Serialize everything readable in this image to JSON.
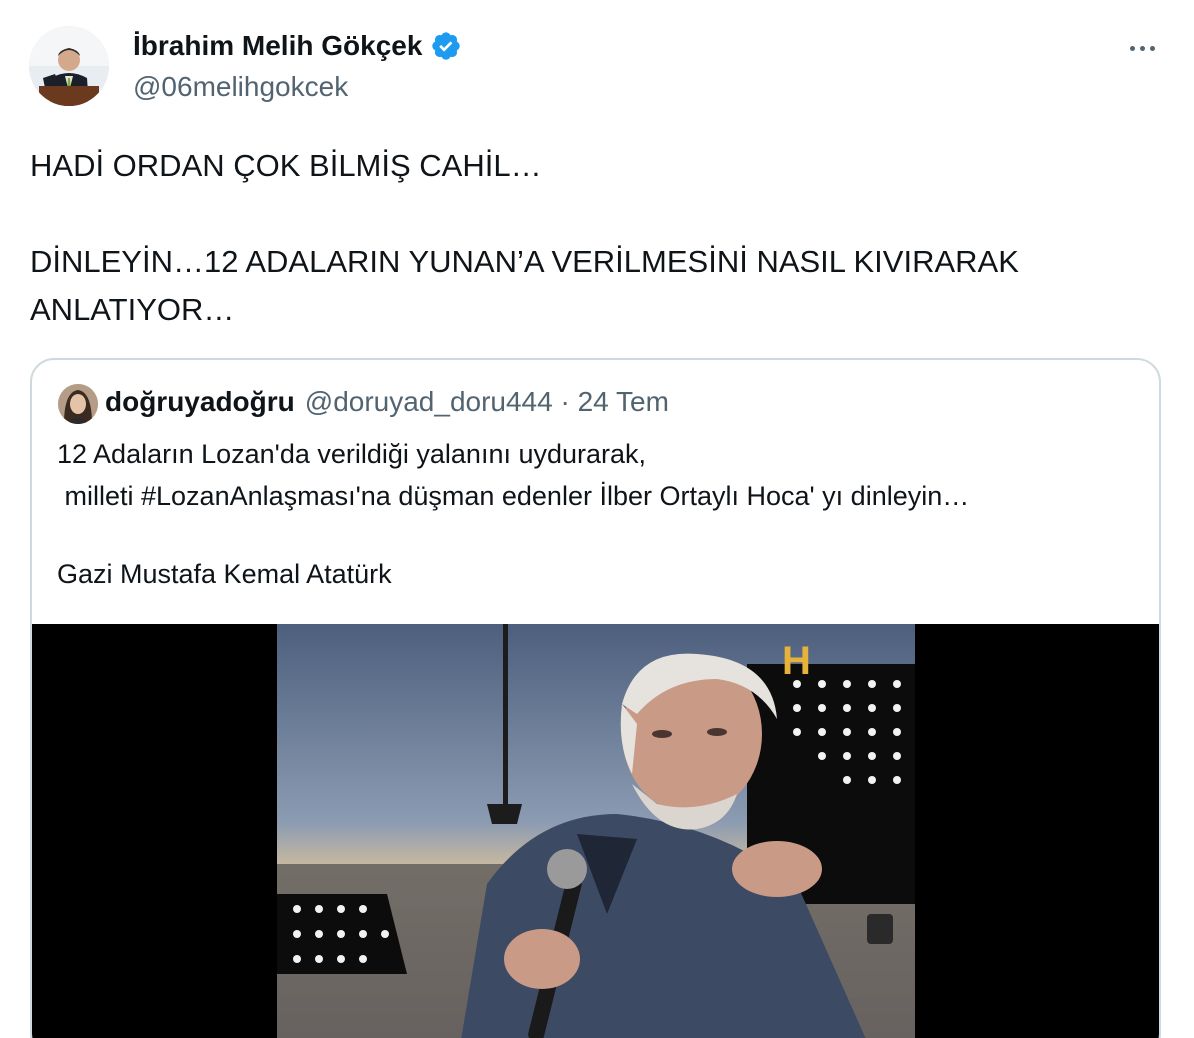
{
  "author": {
    "display_name": "İbrahim Melih Gökçek",
    "handle": "@06melihgokcek",
    "verified": true,
    "verified_color": "#1d9bf0"
  },
  "tweet": {
    "line1": "HADİ ORDAN ÇOK BİLMİŞ CAHİL…",
    "line2": "DİNLEYİN…12 ADALARIN YUNAN’A VERİLMESİNİ NASIL KIVIRARAK",
    "line3": "ANLATIYOR…"
  },
  "quoted": {
    "display_name": "doğruyadoğru",
    "meta": "@doruyad_doru444 · 24 Tem",
    "line1": "12 Adaların Lozan'da verildiği yalanını uydurarak,",
    "line2": " milleti #LozanAnlaşması'na düşman edenler İlber Ortaylı Hoca' yı dinleyin…",
    "line3": "Gazi Mustafa Kemal Atatürk"
  },
  "media": {
    "channel_logo": "H"
  },
  "colors": {
    "text": "#0f1419",
    "secondary": "#536471",
    "border": "#cfd9de"
  }
}
